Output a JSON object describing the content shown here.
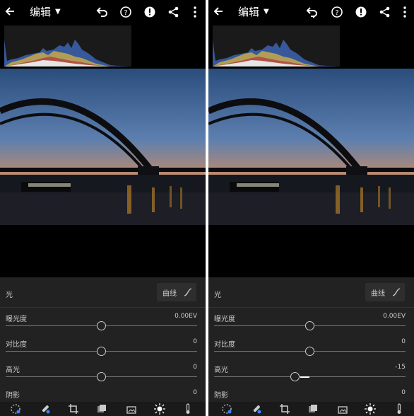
{
  "screens": [
    {
      "title": "编辑",
      "section_label": "光",
      "curve_label": "曲线",
      "sliders": [
        {
          "label": "曝光度",
          "value": "0.00EV",
          "level": 0.5
        },
        {
          "label": "对比度",
          "value": "0",
          "level": 0.5
        },
        {
          "label": "高光",
          "value": "0",
          "level": 0.5
        },
        {
          "label": "阴影",
          "value": "0",
          "level": 0.5
        }
      ]
    },
    {
      "title": "编辑",
      "section_label": "光",
      "curve_label": "曲线",
      "sliders": [
        {
          "label": "曝光度",
          "value": "0.00EV",
          "level": 0.5
        },
        {
          "label": "对比度",
          "value": "0",
          "level": 0.5
        },
        {
          "label": "高光",
          "value": "-15",
          "level": 0.425
        },
        {
          "label": "阴影",
          "value": "0",
          "level": 0.5
        }
      ]
    }
  ],
  "icons": {
    "top": [
      "back-arrow-icon",
      "undo-icon",
      "help-icon",
      "alert-icon",
      "share-icon",
      "more-icon"
    ],
    "bottom": [
      "presets-icon",
      "healing-icon",
      "crop-icon",
      "selective-icon",
      "profile-icon",
      "light-icon",
      "color-icon"
    ]
  },
  "colors": {
    "accent": "#ffffff",
    "panel": "#222222",
    "track": "#777777"
  }
}
